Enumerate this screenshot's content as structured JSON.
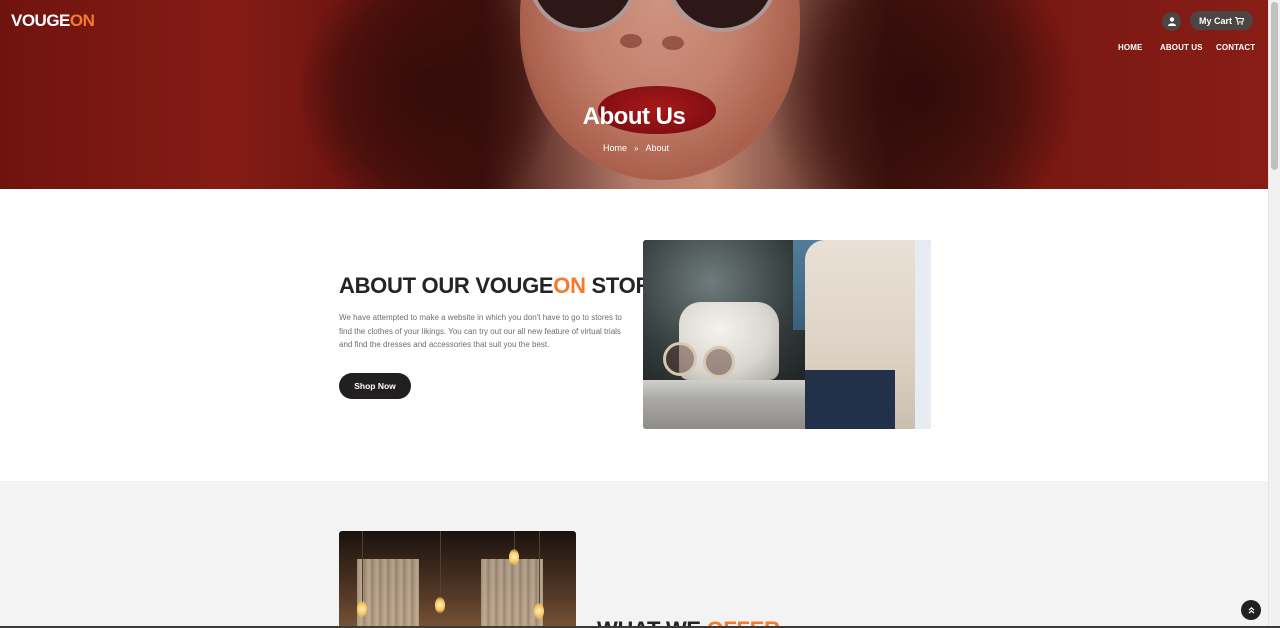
{
  "brand": {
    "name_main": "VOUGE",
    "name_accent": "ON",
    "accent_color": "#f57b2b"
  },
  "header": {
    "cart_label": "My Cart",
    "user_icon": "user-icon",
    "cart_icon": "shopping-cart-icon",
    "nav": [
      "HOME",
      "ABOUT US",
      "CONTACT"
    ]
  },
  "hero": {
    "title": "About Us",
    "breadcrumb": {
      "home": "Home",
      "separator": "»",
      "current": "About"
    }
  },
  "about": {
    "title_pre": "ABOUT OUR VOUGE",
    "title_accent": "ON",
    "title_post": " STORE",
    "text": "We have attempted to make a website in which you don't have to go to stores to find the clothes of your likings. You can try out our all new feature of virtual trials and find the dresses and accessories that suit you the best.",
    "button": "Shop Now"
  },
  "offer": {
    "title_pre": "WHAT WE ",
    "title_accent": "OFFER"
  },
  "scroll_top_icon": "chevron-double-up-icon"
}
